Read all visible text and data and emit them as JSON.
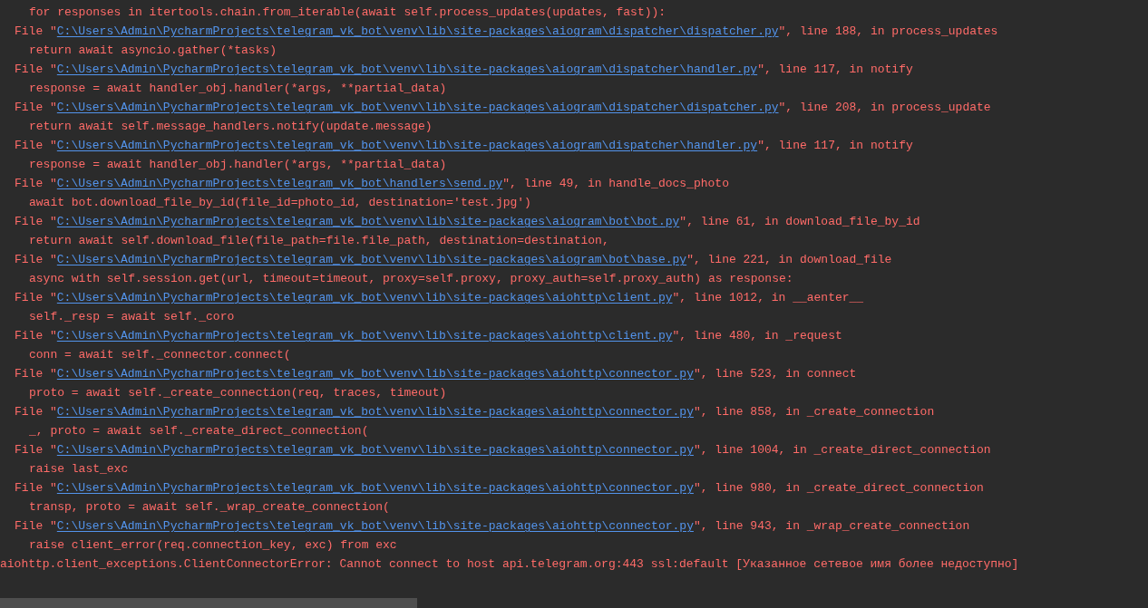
{
  "console_lines": [
    {
      "kind": "code",
      "text": "for responses in itertools.chain.from_iterable(await self.process_updates(updates, fast)):"
    },
    {
      "kind": "frame",
      "prefix": "File \"",
      "path": "C:\\Users\\Admin\\PycharmProjects\\telegram_vk_bot\\venv\\lib\\site-packages\\aiogram\\dispatcher\\dispatcher.py",
      "suffix": "\", line 188, in process_updates"
    },
    {
      "kind": "code",
      "text": "return await asyncio.gather(*tasks)"
    },
    {
      "kind": "frame",
      "prefix": "File \"",
      "path": "C:\\Users\\Admin\\PycharmProjects\\telegram_vk_bot\\venv\\lib\\site-packages\\aiogram\\dispatcher\\handler.py",
      "suffix": "\", line 117, in notify"
    },
    {
      "kind": "code",
      "text": "response = await handler_obj.handler(*args, **partial_data)"
    },
    {
      "kind": "frame",
      "prefix": "File \"",
      "path": "C:\\Users\\Admin\\PycharmProjects\\telegram_vk_bot\\venv\\lib\\site-packages\\aiogram\\dispatcher\\dispatcher.py",
      "suffix": "\", line 208, in process_update"
    },
    {
      "kind": "code",
      "text": "return await self.message_handlers.notify(update.message)"
    },
    {
      "kind": "frame",
      "prefix": "File \"",
      "path": "C:\\Users\\Admin\\PycharmProjects\\telegram_vk_bot\\venv\\lib\\site-packages\\aiogram\\dispatcher\\handler.py",
      "suffix": "\", line 117, in notify"
    },
    {
      "kind": "code",
      "text": "response = await handler_obj.handler(*args, **partial_data)"
    },
    {
      "kind": "frame",
      "prefix": "File \"",
      "path": "C:\\Users\\Admin\\PycharmProjects\\telegram_vk_bot\\handlers\\send.py",
      "suffix": "\", line 49, in handle_docs_photo"
    },
    {
      "kind": "code",
      "text": "await bot.download_file_by_id(file_id=photo_id, destination='test.jpg')"
    },
    {
      "kind": "frame",
      "prefix": "File \"",
      "path": "C:\\Users\\Admin\\PycharmProjects\\telegram_vk_bot\\venv\\lib\\site-packages\\aiogram\\bot\\bot.py",
      "suffix": "\", line 61, in download_file_by_id"
    },
    {
      "kind": "code",
      "text": "return await self.download_file(file_path=file.file_path, destination=destination,"
    },
    {
      "kind": "frame",
      "prefix": "File \"",
      "path": "C:\\Users\\Admin\\PycharmProjects\\telegram_vk_bot\\venv\\lib\\site-packages\\aiogram\\bot\\base.py",
      "suffix": "\", line 221, in download_file"
    },
    {
      "kind": "code",
      "text": "async with self.session.get(url, timeout=timeout, proxy=self.proxy, proxy_auth=self.proxy_auth) as response:"
    },
    {
      "kind": "frame",
      "prefix": "File \"",
      "path": "C:\\Users\\Admin\\PycharmProjects\\telegram_vk_bot\\venv\\lib\\site-packages\\aiohttp\\client.py",
      "suffix": "\", line 1012, in __aenter__"
    },
    {
      "kind": "code",
      "text": "self._resp = await self._coro"
    },
    {
      "kind": "frame",
      "prefix": "File \"",
      "path": "C:\\Users\\Admin\\PycharmProjects\\telegram_vk_bot\\venv\\lib\\site-packages\\aiohttp\\client.py",
      "suffix": "\", line 480, in _request"
    },
    {
      "kind": "code",
      "text": "conn = await self._connector.connect("
    },
    {
      "kind": "frame",
      "prefix": "File \"",
      "path": "C:\\Users\\Admin\\PycharmProjects\\telegram_vk_bot\\venv\\lib\\site-packages\\aiohttp\\connector.py",
      "suffix": "\", line 523, in connect"
    },
    {
      "kind": "code",
      "text": "proto = await self._create_connection(req, traces, timeout)"
    },
    {
      "kind": "frame",
      "prefix": "File \"",
      "path": "C:\\Users\\Admin\\PycharmProjects\\telegram_vk_bot\\venv\\lib\\site-packages\\aiohttp\\connector.py",
      "suffix": "\", line 858, in _create_connection"
    },
    {
      "kind": "code",
      "text": "_, proto = await self._create_direct_connection("
    },
    {
      "kind": "frame",
      "prefix": "File \"",
      "path": "C:\\Users\\Admin\\PycharmProjects\\telegram_vk_bot\\venv\\lib\\site-packages\\aiohttp\\connector.py",
      "suffix": "\", line 1004, in _create_direct_connection"
    },
    {
      "kind": "code",
      "text": "raise last_exc"
    },
    {
      "kind": "frame",
      "prefix": "File \"",
      "path": "C:\\Users\\Admin\\PycharmProjects\\telegram_vk_bot\\venv\\lib\\site-packages\\aiohttp\\connector.py",
      "suffix": "\", line 980, in _create_direct_connection"
    },
    {
      "kind": "code",
      "text": "transp, proto = await self._wrap_create_connection("
    },
    {
      "kind": "frame",
      "prefix": "File \"",
      "path": "C:\\Users\\Admin\\PycharmProjects\\telegram_vk_bot\\venv\\lib\\site-packages\\aiohttp\\connector.py",
      "suffix": "\", line 943, in _wrap_create_connection"
    },
    {
      "kind": "code",
      "text": "raise client_error(req.connection_key, exc) from exc"
    },
    {
      "kind": "error",
      "text": "aiohttp.client_exceptions.ClientConnectorError: Cannot connect to host api.telegram.org:443 ssl:default [Указанное сетевое имя более недоступно]"
    }
  ]
}
